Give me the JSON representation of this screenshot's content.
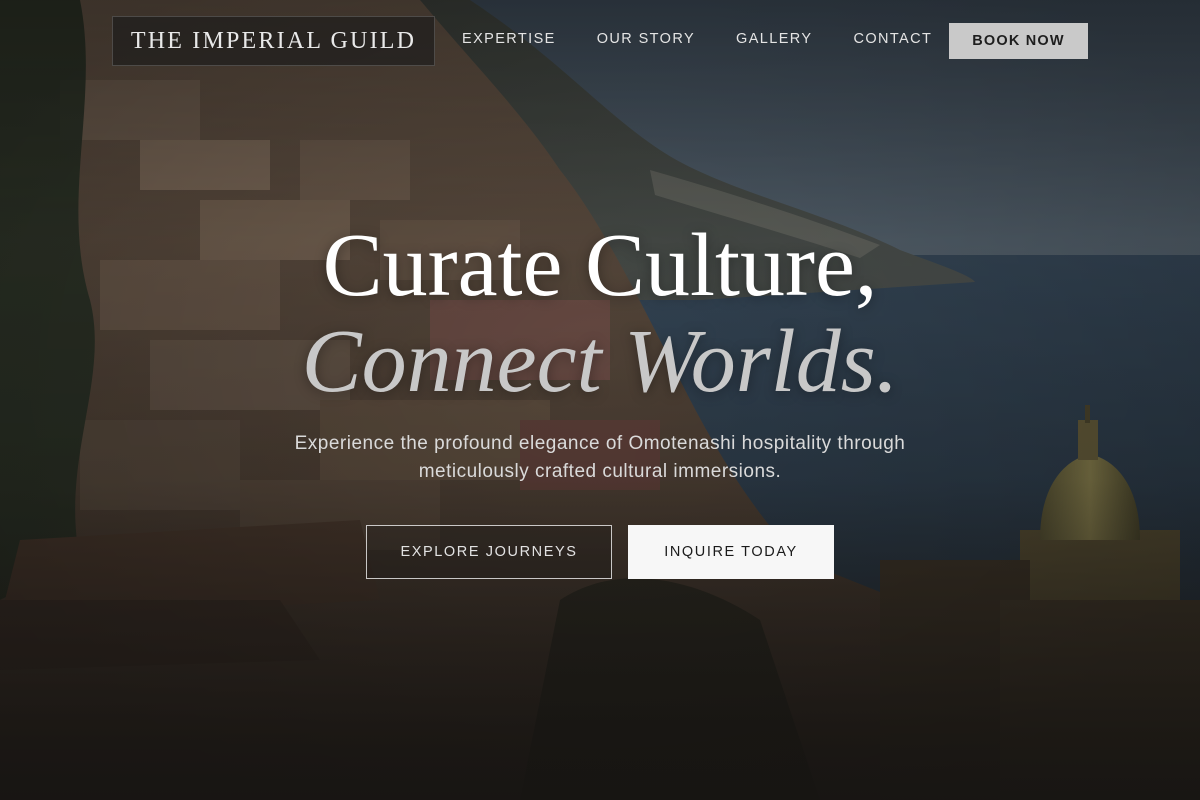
{
  "brand": {
    "name": "THE IMPERIAL GUILD"
  },
  "nav": {
    "items": [
      {
        "label": "EXPERTISE"
      },
      {
        "label": "OUR STORY"
      },
      {
        "label": "GALLERY"
      },
      {
        "label": "CONTACT"
      }
    ],
    "cta_label": "BOOK NOW"
  },
  "hero": {
    "headline_line1": "Curate Culture,",
    "headline_line2": "Connect Worlds.",
    "subtitle": "Experience the profound elegance of Omotenashi hospitality through meticulously crafted cultural immersions.",
    "primary_button": "EXPLORE JOURNEYS",
    "secondary_button": "INQUIRE TODAY"
  },
  "colors": {
    "book_button_bg": "#c9c9c9",
    "inquire_button_bg": "#f7f7f7",
    "headline_line1": "#ffffff",
    "headline_line2": "#c8c8c8"
  }
}
